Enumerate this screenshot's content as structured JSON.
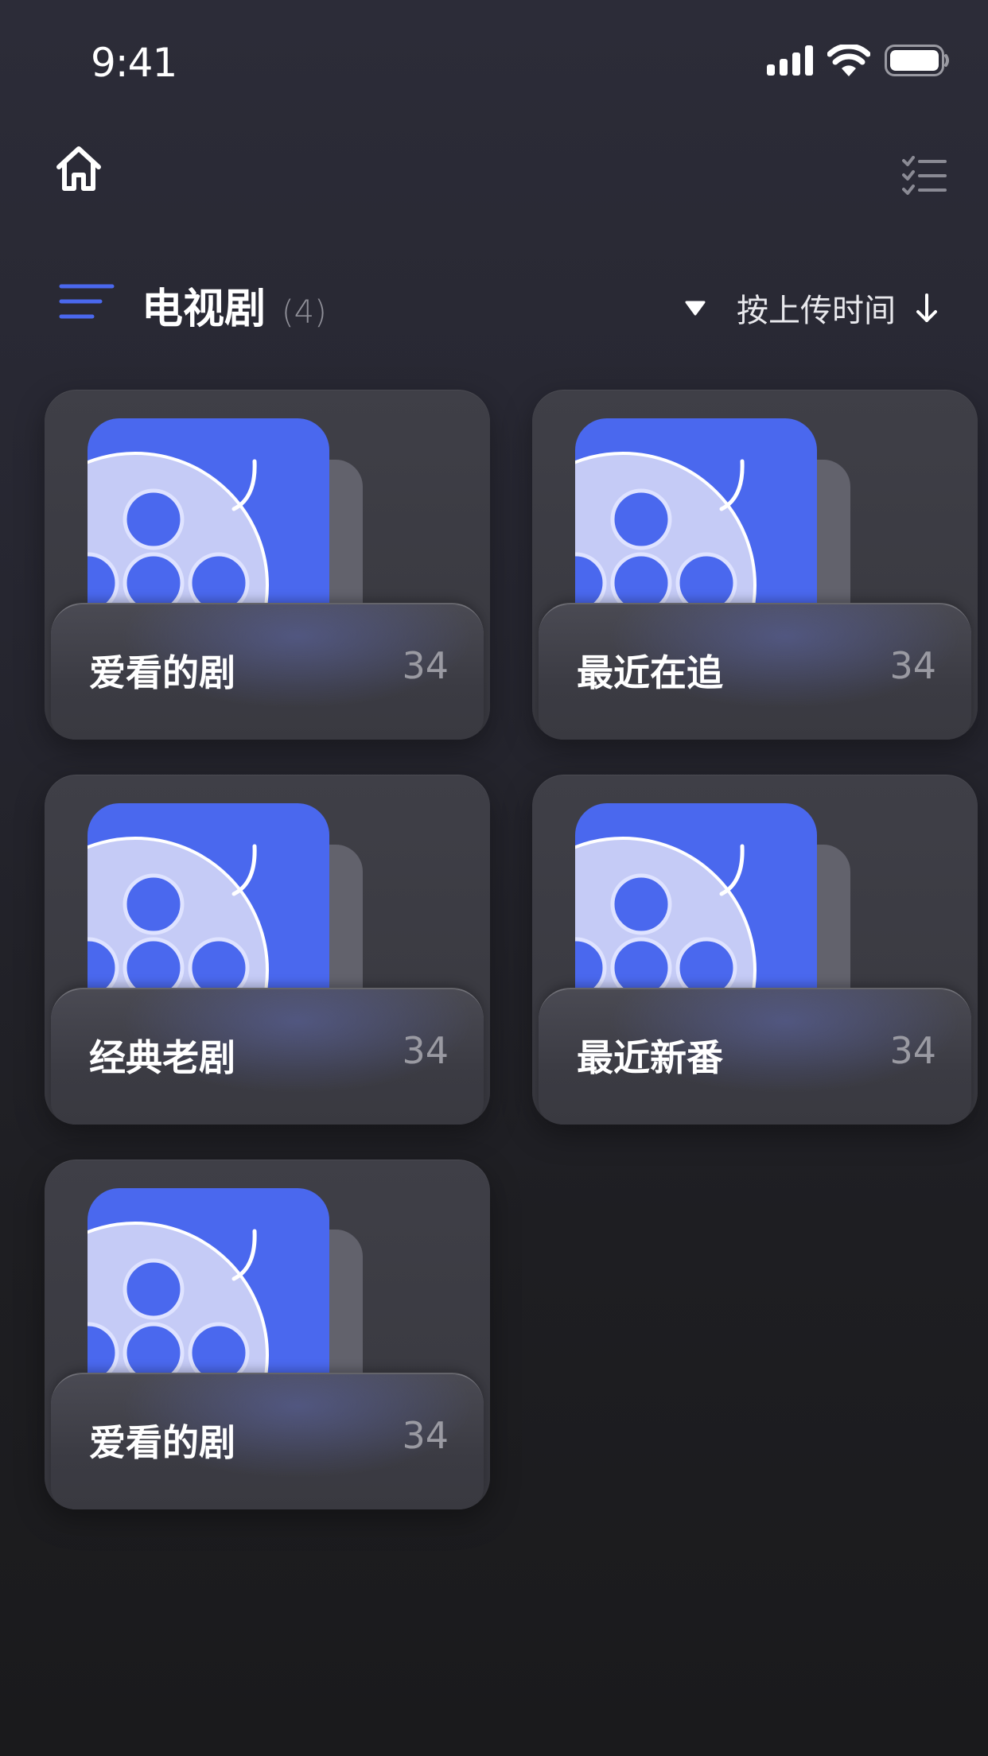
{
  "status_bar": {
    "time": "9:41",
    "icons": [
      "cellular-signal-icon",
      "wifi-icon",
      "battery-icon"
    ]
  },
  "nav": {
    "left_icon": "home-icon",
    "right_icon": "checklist-icon"
  },
  "section": {
    "menu_icon": "menu-icon",
    "title": "电视剧",
    "count": "(4)",
    "sort_label": "按上传时间",
    "sort_icons": [
      "caret-down-icon",
      "arrow-down-icon"
    ]
  },
  "colors": {
    "accent": "#4a68ee",
    "reel": "#c5cbf6",
    "background_top": "#2c2c38",
    "background_bottom": "#1a1a1c",
    "card": "#3c3c44",
    "muted_text": "#9a9aa2"
  },
  "folders": [
    {
      "title": "爱看的剧",
      "count": "34"
    },
    {
      "title": "最近在追",
      "count": "34"
    },
    {
      "title": "经典老剧",
      "count": "34"
    },
    {
      "title": "最近新番",
      "count": "34"
    },
    {
      "title": "爱看的剧",
      "count": "34"
    }
  ]
}
